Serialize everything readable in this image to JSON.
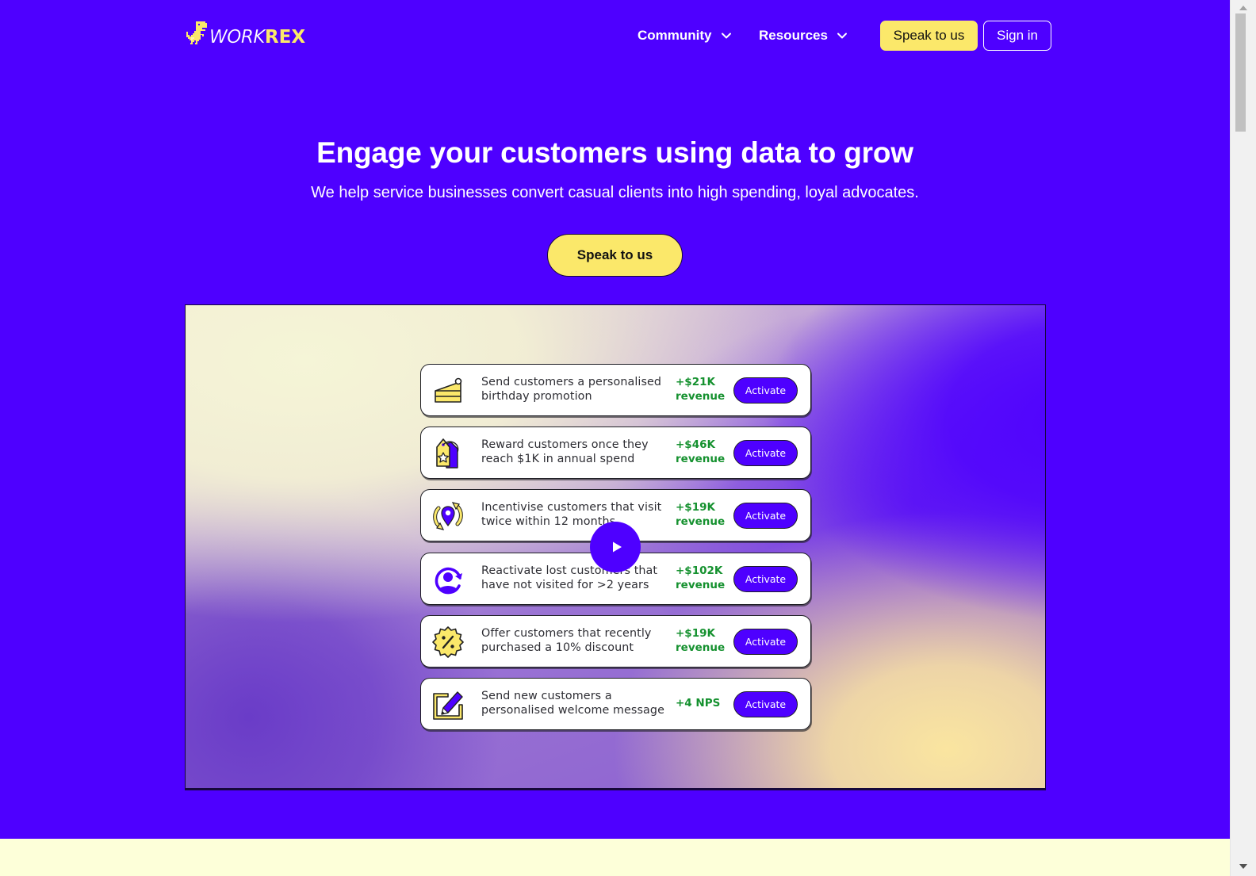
{
  "brand": {
    "logo_work": "WORK",
    "logo_rex": "REX",
    "colors": {
      "primary": "#4e00ff",
      "accent_yellow": "#fbe86a",
      "metric_green": "#15912f",
      "cream": "#fdffd9"
    }
  },
  "nav": {
    "items": [
      {
        "label": "Community",
        "icon": "chevron-down-icon"
      },
      {
        "label": "Resources",
        "icon": "chevron-down-icon"
      }
    ],
    "speak_label": "Speak to us",
    "signin_label": "Sign in"
  },
  "hero": {
    "title": "Engage your customers using data to grow",
    "subtitle": "We help service businesses convert casual clients into high spending, loyal advocates.",
    "cta_label": "Speak to us"
  },
  "video": {
    "play_icon": "play-icon",
    "cards": [
      {
        "icon": "cake-icon",
        "text": "Send customers a personalised birthday promotion",
        "metric_line1": "+$21K",
        "metric_line2": "revenue",
        "button": "Activate"
      },
      {
        "icon": "price-tag-star-icon",
        "text": "Reward customers once they reach $1K in annual spend",
        "metric_line1": "+$46K",
        "metric_line2": "revenue",
        "button": "Activate"
      },
      {
        "icon": "location-refresh-icon",
        "text": "Incentivise customers that visit twice within 12 months",
        "metric_line1": "+$19K",
        "metric_line2": "revenue",
        "button": "Activate"
      },
      {
        "icon": "user-refresh-icon",
        "text": "Reactivate lost customers that have not visited for >2 years",
        "metric_line1": "+$102K",
        "metric_line2": "revenue",
        "button": "Activate"
      },
      {
        "icon": "discount-badge-icon",
        "text": "Offer customers that recently purchased a 10% discount",
        "metric_line1": "+$19K",
        "metric_line2": "revenue",
        "button": "Activate"
      },
      {
        "icon": "edit-note-icon",
        "text": "Send new customers a personalised welcome message",
        "metric_line1": "+4 NPS",
        "metric_line2": "",
        "button": "Activate"
      }
    ]
  }
}
